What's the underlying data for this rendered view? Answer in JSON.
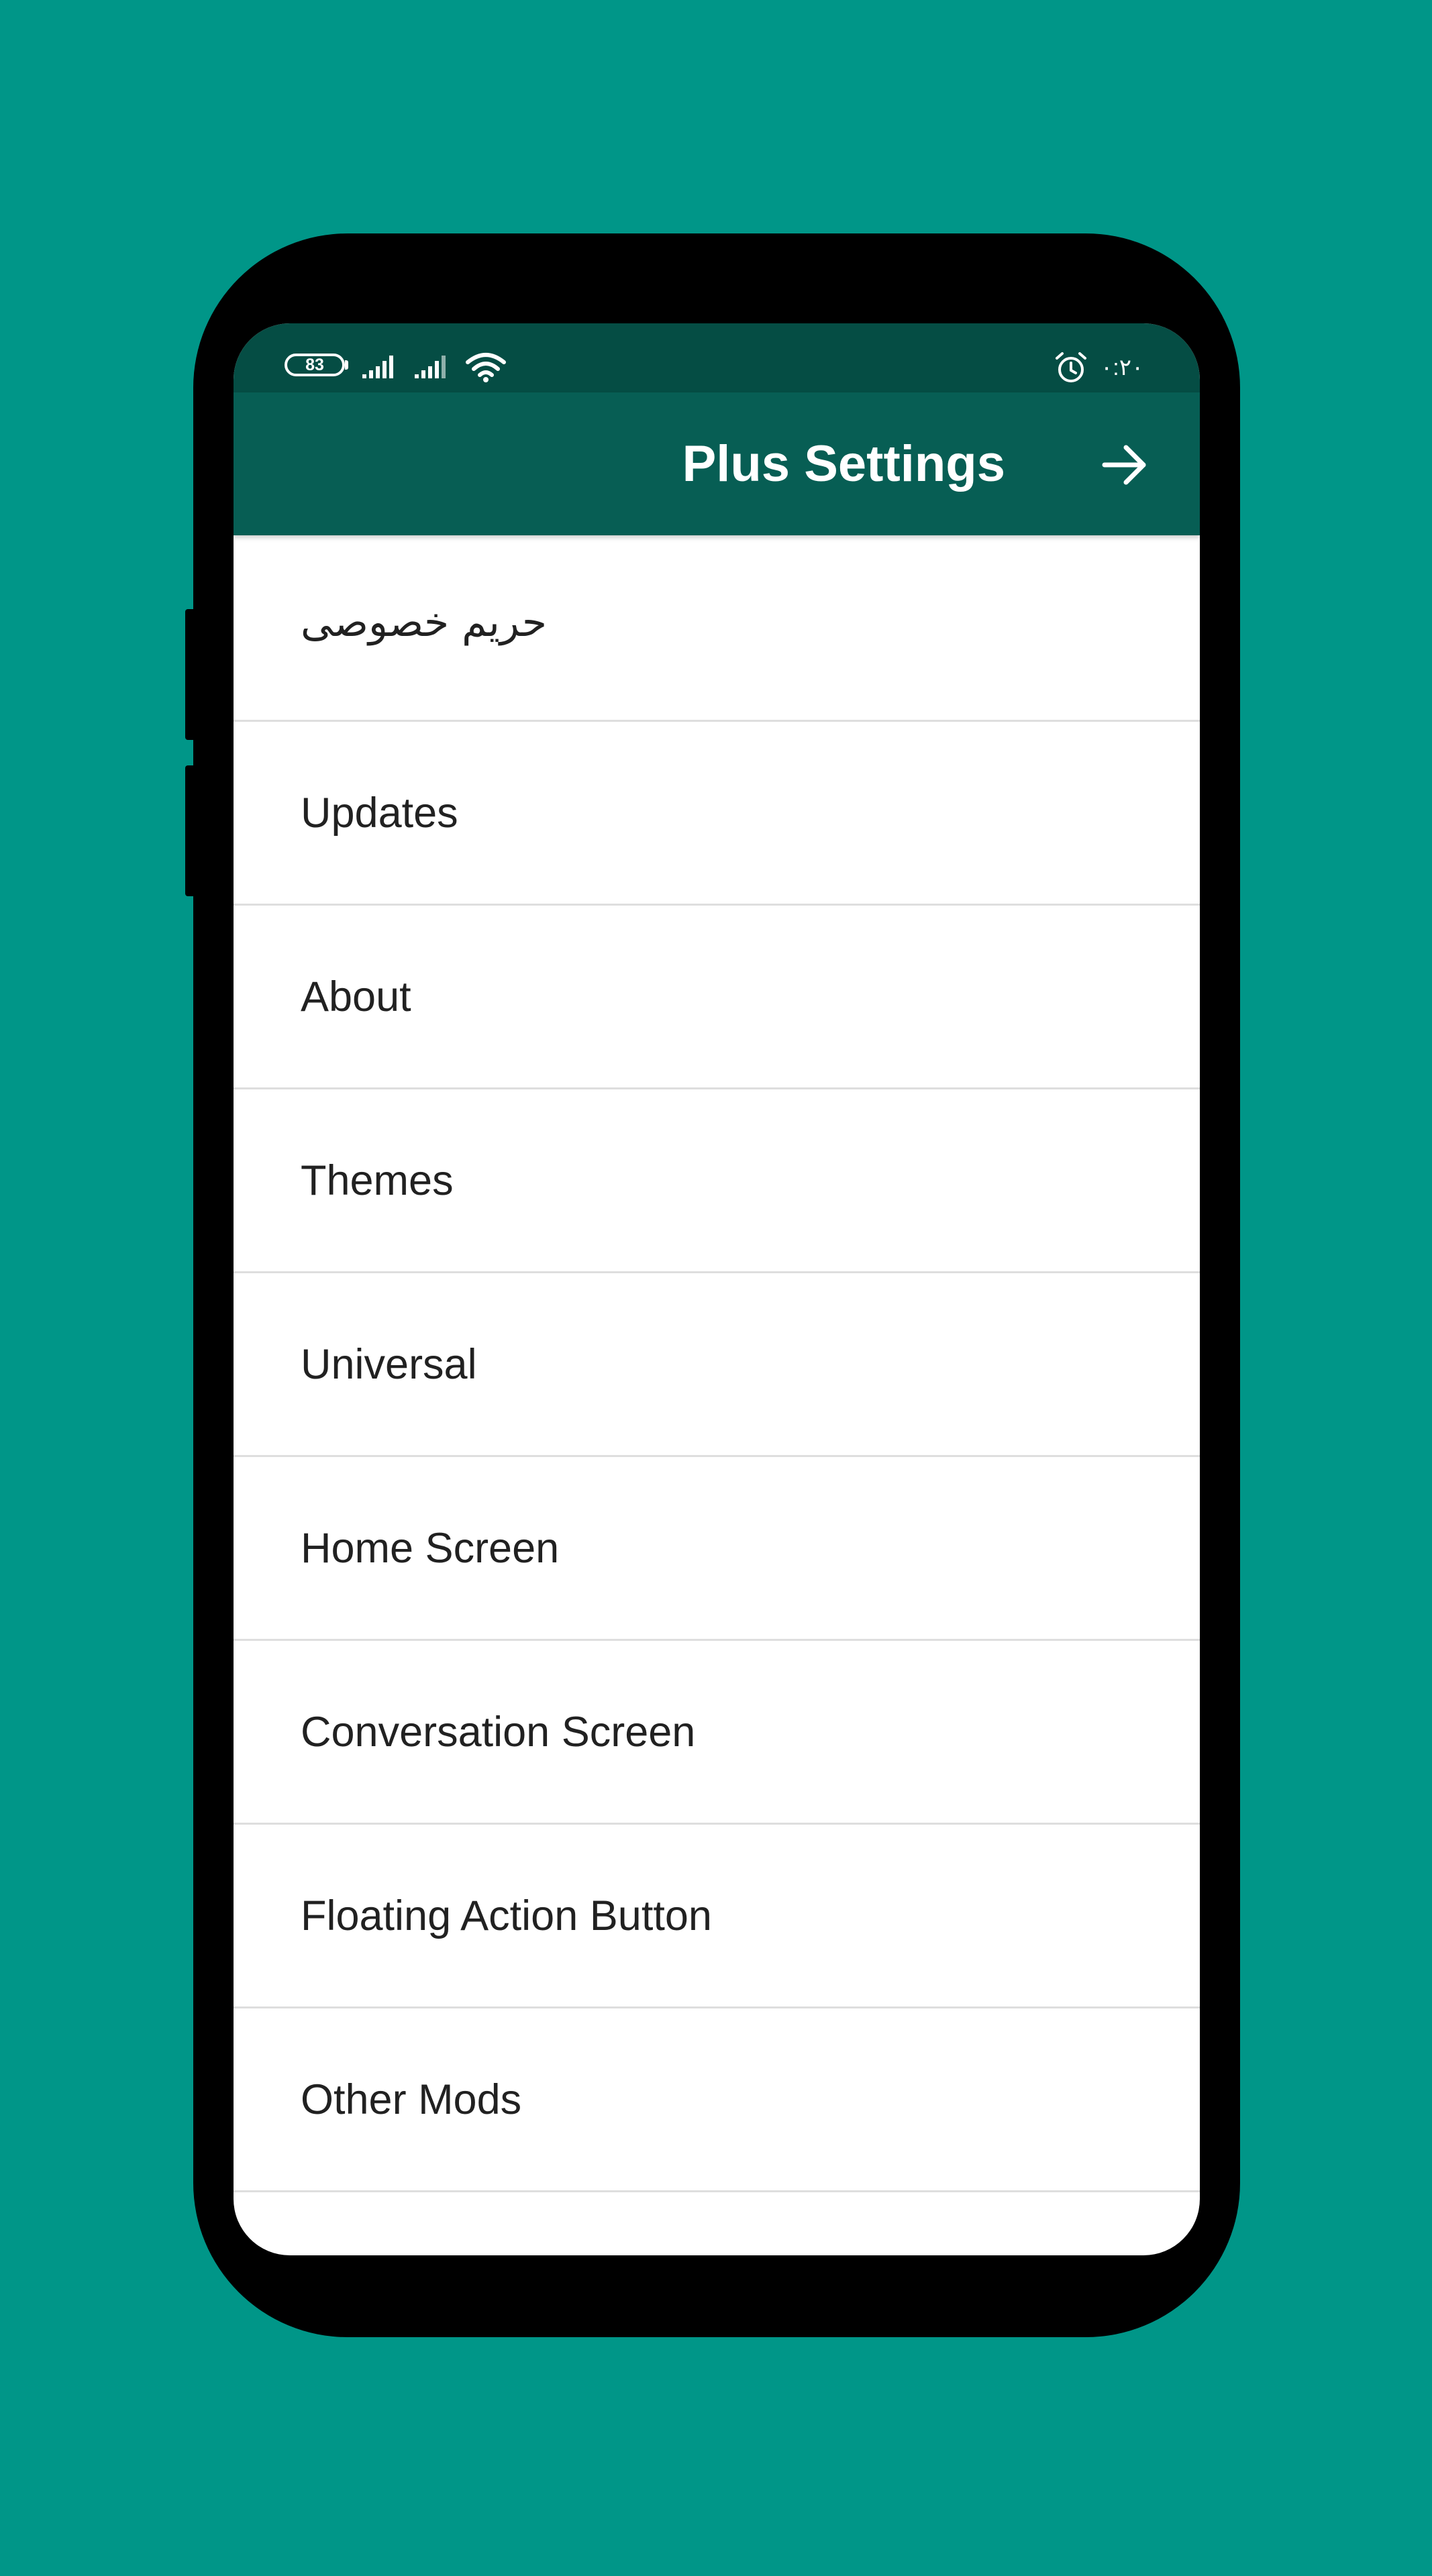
{
  "status_bar": {
    "battery_level": "83",
    "clock": "۰:۲۰",
    "icons": [
      "battery-icon",
      "signal-icon",
      "signal-icon",
      "wifi-icon",
      "alarm-icon"
    ]
  },
  "app_bar": {
    "title": "Plus Settings",
    "back_icon": "arrow-right-icon"
  },
  "colors": {
    "background": "#009688",
    "status_bar": "#054d44",
    "app_bar": "#075e54",
    "list_background": "#ffffff",
    "divider": "#dedede",
    "text": "#212121"
  },
  "settings_list": {
    "items": [
      {
        "label": "حریم خصوصی"
      },
      {
        "label": "Updates"
      },
      {
        "label": "About"
      },
      {
        "label": "Themes"
      },
      {
        "label": "Universal"
      },
      {
        "label": "Home Screen"
      },
      {
        "label": "Conversation Screen"
      },
      {
        "label": "Floating Action Button"
      },
      {
        "label": "Other Mods"
      }
    ]
  }
}
